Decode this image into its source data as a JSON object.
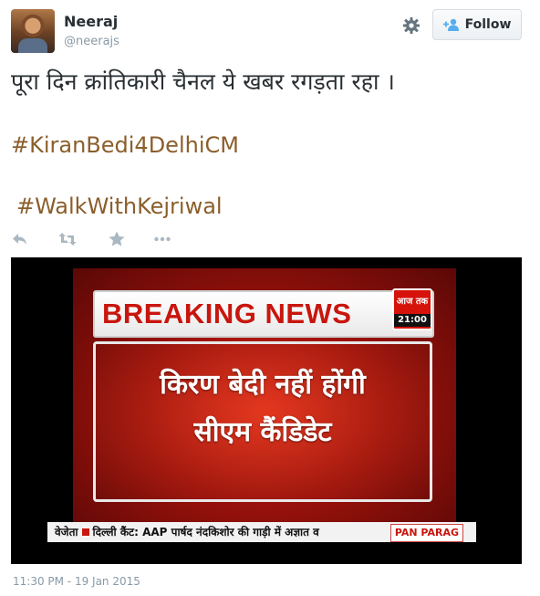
{
  "user": {
    "name": "Neeraj",
    "handle": "@neerajs"
  },
  "header": {
    "follow_label": "Follow"
  },
  "tweet": {
    "text": "पूरा दिन क्रांतिकारी चैनल ये खबर रगड़ता रहा ।",
    "hashtags": [
      "#KiranBedi4DelhiCM",
      "#WalkWithKejriwal"
    ],
    "timestamp": "11:30 PM - 19 Jan 2015"
  },
  "actions": {
    "icons": [
      "reply-icon",
      "retweet-icon",
      "favorite-icon",
      "more-icon"
    ]
  },
  "media": {
    "breaking_title": "BREAKING NEWS",
    "channel_logo": "आज तक",
    "channel_time": "21:00",
    "headline_line1": "किरण बेदी नहीं होंगी",
    "headline_line2": "सीएम कैंडिडेट",
    "ticker_left": "वेजेता",
    "ticker_text": "दिल्ली कैंट: AAP पार्षद नंदकिशोर की गाड़ी में अज्ञात व",
    "sponsor": "PAN PARAG"
  },
  "colors": {
    "hashtag": "#8b5e2b",
    "muted": "#8899a6",
    "breaking_red": "#c8160e"
  }
}
